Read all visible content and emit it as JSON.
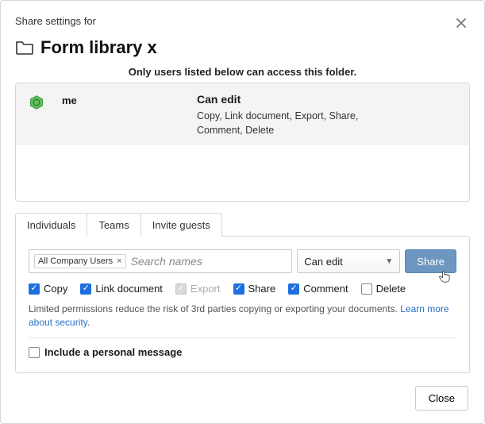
{
  "header": {
    "pretitle": "Share settings for",
    "title": "Form library x"
  },
  "subtitle": "Only users listed below can access this folder.",
  "users": [
    {
      "name": "me",
      "perm_title": "Can edit",
      "perm_detail": "Copy, Link document, Export, Share, Comment, Delete"
    }
  ],
  "tabs": {
    "individuals": "Individuals",
    "teams": "Teams",
    "invite": "Invite guests",
    "active": "teams"
  },
  "search": {
    "chip": "All Company Users",
    "placeholder": "Search names"
  },
  "perm_select": {
    "value": "Can edit"
  },
  "share_button": "Share",
  "permissions": [
    {
      "key": "copy",
      "label": "Copy",
      "checked": true,
      "disabled": false
    },
    {
      "key": "link",
      "label": "Link document",
      "checked": true,
      "disabled": false
    },
    {
      "key": "export",
      "label": "Export",
      "checked": true,
      "disabled": true
    },
    {
      "key": "share",
      "label": "Share",
      "checked": true,
      "disabled": false
    },
    {
      "key": "comment",
      "label": "Comment",
      "checked": true,
      "disabled": false
    },
    {
      "key": "delete",
      "label": "Delete",
      "checked": false,
      "disabled": false
    }
  ],
  "helper": {
    "text": "Limited permissions reduce the risk of 3rd parties copying or exporting your documents. ",
    "link": "Learn more about security"
  },
  "personal_msg": {
    "label": "Include a personal message",
    "checked": false
  },
  "footer": {
    "close": "Close"
  },
  "colors": {
    "accent": "#1e6fe0",
    "share_btn": "#6d97c1"
  }
}
